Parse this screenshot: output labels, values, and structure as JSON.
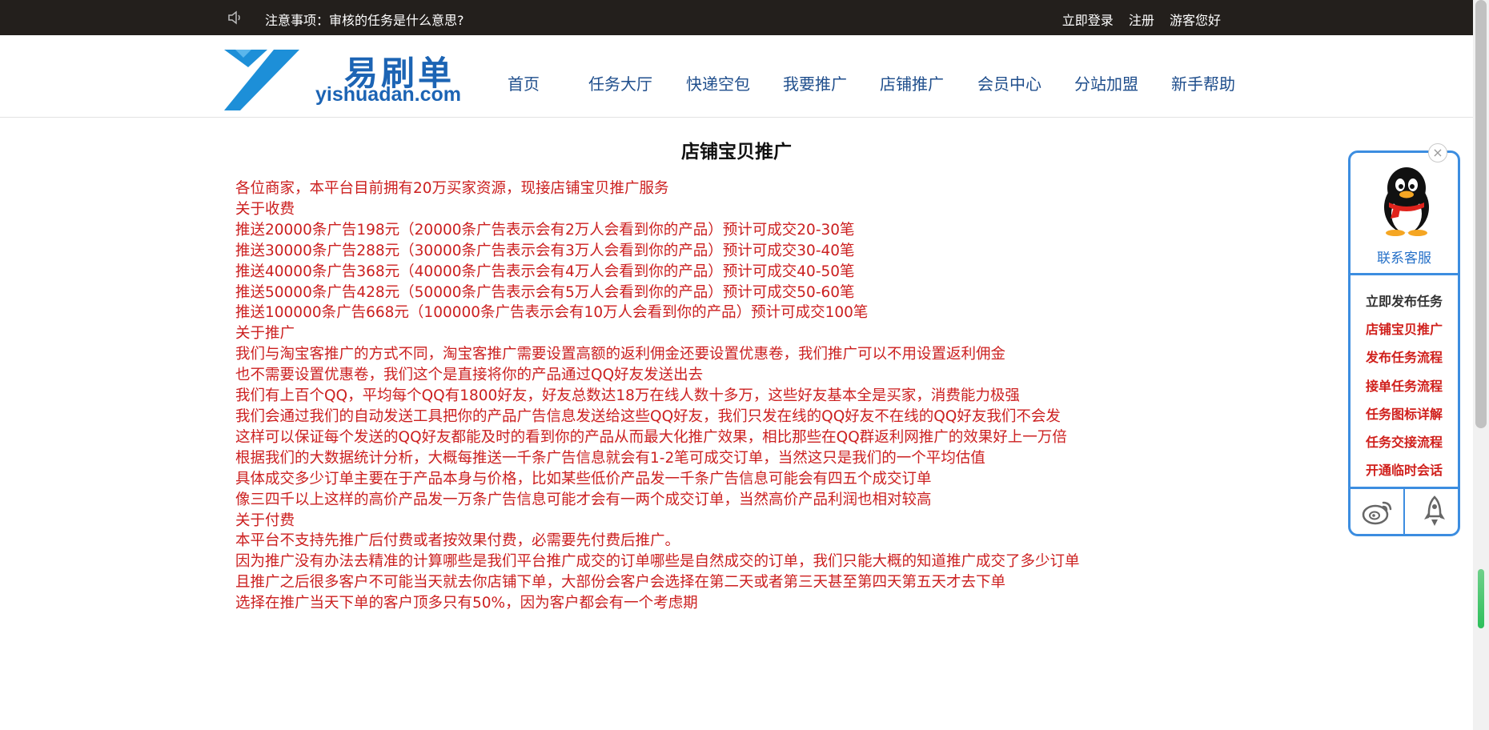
{
  "topbar": {
    "notice": "注意事项：审核的任务是什么意思?",
    "login": "立即登录",
    "register": "注册",
    "greeting": "游客您好"
  },
  "logo": {
    "name": "易刷单",
    "domain": "yishuadan.com"
  },
  "nav": [
    {
      "label": "首页"
    },
    {
      "label": "任务大厅"
    },
    {
      "label": "快递空包"
    },
    {
      "label": "我要推广"
    },
    {
      "label": "店铺推广"
    },
    {
      "label": "会员中心"
    },
    {
      "label": "分站加盟"
    },
    {
      "label": "新手帮助"
    }
  ],
  "main": {
    "title": "店铺宝贝推广",
    "lines": [
      "各位商家，本平台目前拥有20万买家资源，现接店铺宝贝推广服务",
      "关于收费",
      "推送20000条广告198元（20000条广告表示会有2万人会看到你的产品）预计可成交20-30笔",
      "推送30000条广告288元（30000条广告表示会有3万人会看到你的产品）预计可成交30-40笔",
      "推送40000条广告368元（40000条广告表示会有4万人会看到你的产品）预计可成交40-50笔",
      "推送50000条广告428元（50000条广告表示会有5万人会看到你的产品）预计可成交50-60笔",
      "推送100000条广告668元（100000条广告表示会有10万人会看到你的产品）预计可成交100笔",
      "关于推广",
      "我们与淘宝客推广的方式不同，淘宝客推广需要设置高额的返利佣金还要设置优惠卷，我们推广可以不用设置返利佣金",
      "也不需要设置优惠卷，我们这个是直接将你的产品通过QQ好友发送出去",
      "我们有上百个QQ，平均每个QQ有1800好友，好友总数达18万在线人数十多万，这些好友基本全是买家，消费能力极强",
      "我们会通过我们的自动发送工具把你的产品广告信息发送给这些QQ好友，我们只发在线的QQ好友不在线的QQ好友我们不会发",
      "这样可以保证每个发送的QQ好友都能及时的看到你的产品从而最大化推广效果，相比那些在QQ群返利网推广的效果好上一万倍",
      "根据我们的大数据统计分析，大概每推送一千条广告信息就会有1-2笔可成交订单，当然这只是我们的一个平均估值",
      "具体成交多少订单主要在于产品本身与价格，比如某些低价产品发一千条广告信息可能会有四五个成交订单",
      "像三四千以上这样的高价产品发一万条广告信息可能才会有一两个成交订单，当然高价产品利润也相对较高",
      "关于付费",
      "本平台不支持先推广后付费或者按效果付费，必需要先付费后推广。",
      "因为推广没有办法去精准的计算哪些是我们平台推广成交的订单哪些是自然成交的订单，我们只能大概的知道推广成交了多少订单",
      "且推广之后很多客户不可能当天就去你店铺下单，大部份会客户会选择在第二天或者第三天甚至第四天第五天才去下单",
      "选择在推广当天下单的客户顶多只有50%，因为客户都会有一个考虑期"
    ]
  },
  "sidebar": {
    "close": "×",
    "contact": "联系客服",
    "links": [
      {
        "label": "立即发布任务"
      },
      {
        "label": "店铺宝贝推广"
      },
      {
        "label": "发布任务流程"
      },
      {
        "label": "接单任务流程"
      },
      {
        "label": "任务图标详解"
      },
      {
        "label": "任务交接流程"
      },
      {
        "label": "开通临时会话"
      }
    ]
  },
  "colors": {
    "topbar_bg": "#231f1c",
    "nav_text": "#1f4e8c",
    "content_text": "#cc2020",
    "sidebar_border": "#3c8de0",
    "sidebar_link": "#d0201c"
  },
  "icons": [
    "speaker-icon",
    "qq-penguin-icon",
    "weibo-icon",
    "rocket-icon",
    "close-icon"
  ]
}
